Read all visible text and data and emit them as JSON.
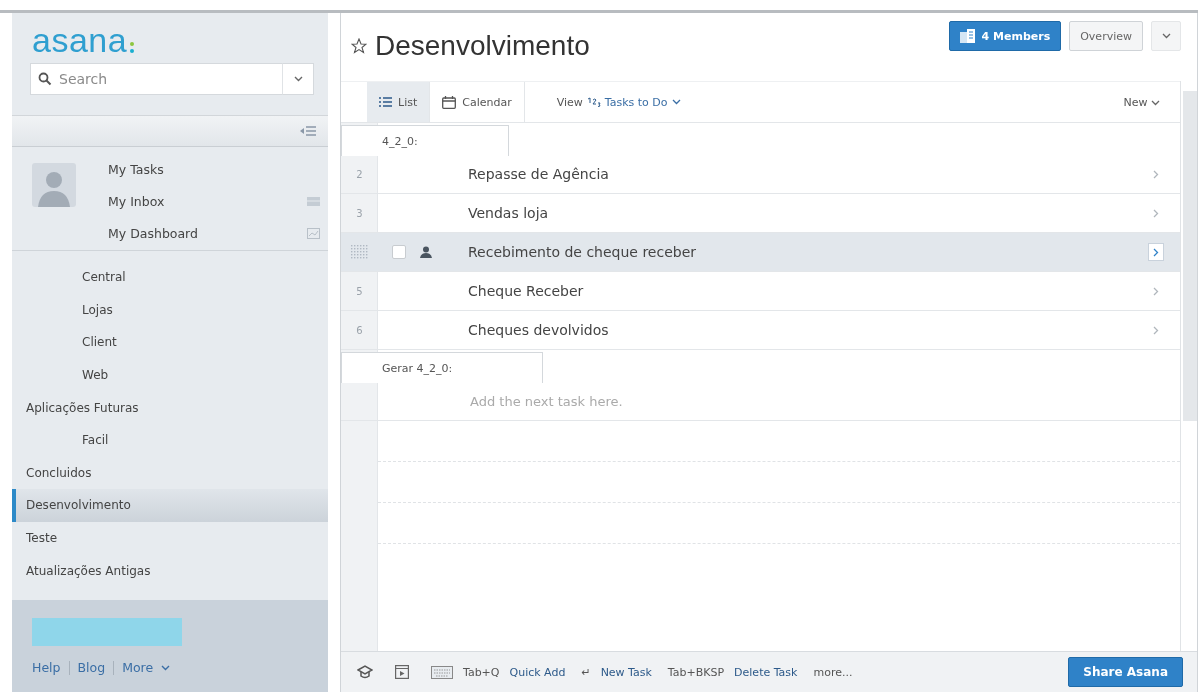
{
  "logo": "asana",
  "search": {
    "placeholder": "Search"
  },
  "nav": [
    {
      "label": "My Tasks",
      "kind": "plain"
    },
    {
      "label": "My Inbox",
      "kind": "inbox"
    },
    {
      "label": "My Dashboard",
      "kind": "dashboard"
    }
  ],
  "sidebar": {
    "items": [
      {
        "children": [
          {
            "label": "Central",
            "selected": false
          },
          {
            "label": "Lojas",
            "selected": false
          },
          {
            "label": "Client",
            "selected": false
          },
          {
            "label": "Web",
            "selected": false
          }
        ]
      },
      {
        "label": "Aplicações Futuras",
        "selected": false,
        "children": [
          {
            "label": "Facil",
            "selected": false
          }
        ]
      },
      {
        "label": "Concluidos",
        "selected": false
      },
      {
        "label": "Desenvolvimento",
        "selected": true
      },
      {
        "label": "Teste",
        "selected": false
      },
      {
        "label": "Atualizações Antigas",
        "selected": false
      }
    ]
  },
  "footer_links": [
    "Help",
    "Blog",
    "More"
  ],
  "project": {
    "title": "Desenvolvimento",
    "members": "4 Members",
    "overview": "Overview"
  },
  "toolbar": {
    "tabs": [
      {
        "label": "List",
        "selected": true
      },
      {
        "label": "Calendar",
        "selected": false
      }
    ],
    "view": "View",
    "sort": "Tasks to Do",
    "new": "New"
  },
  "sections": [
    {
      "header": "4_2_0:",
      "tasks": [
        {
          "number": "2",
          "title": "Repasse de Agência",
          "selected": false
        },
        {
          "number": "3",
          "title": "Vendas loja",
          "selected": false
        },
        {
          "title": "Recebimento de cheque receber",
          "selected": true
        },
        {
          "number": "5",
          "title": "Cheque Receber",
          "selected": false
        },
        {
          "number": "6",
          "title": "Cheques devolvidos",
          "selected": false
        }
      ]
    },
    {
      "header": "Gerar 4_2_0:",
      "add_placeholder": "Add the next task here."
    }
  ],
  "shortcuts": [
    {
      "key": "Tab+Q",
      "action": "Quick Add"
    },
    {
      "key": "↵",
      "action": "New Task"
    },
    {
      "key": "Tab+BKSP",
      "action": "Delete Task"
    }
  ],
  "more": "more...",
  "share": "Share Asana"
}
